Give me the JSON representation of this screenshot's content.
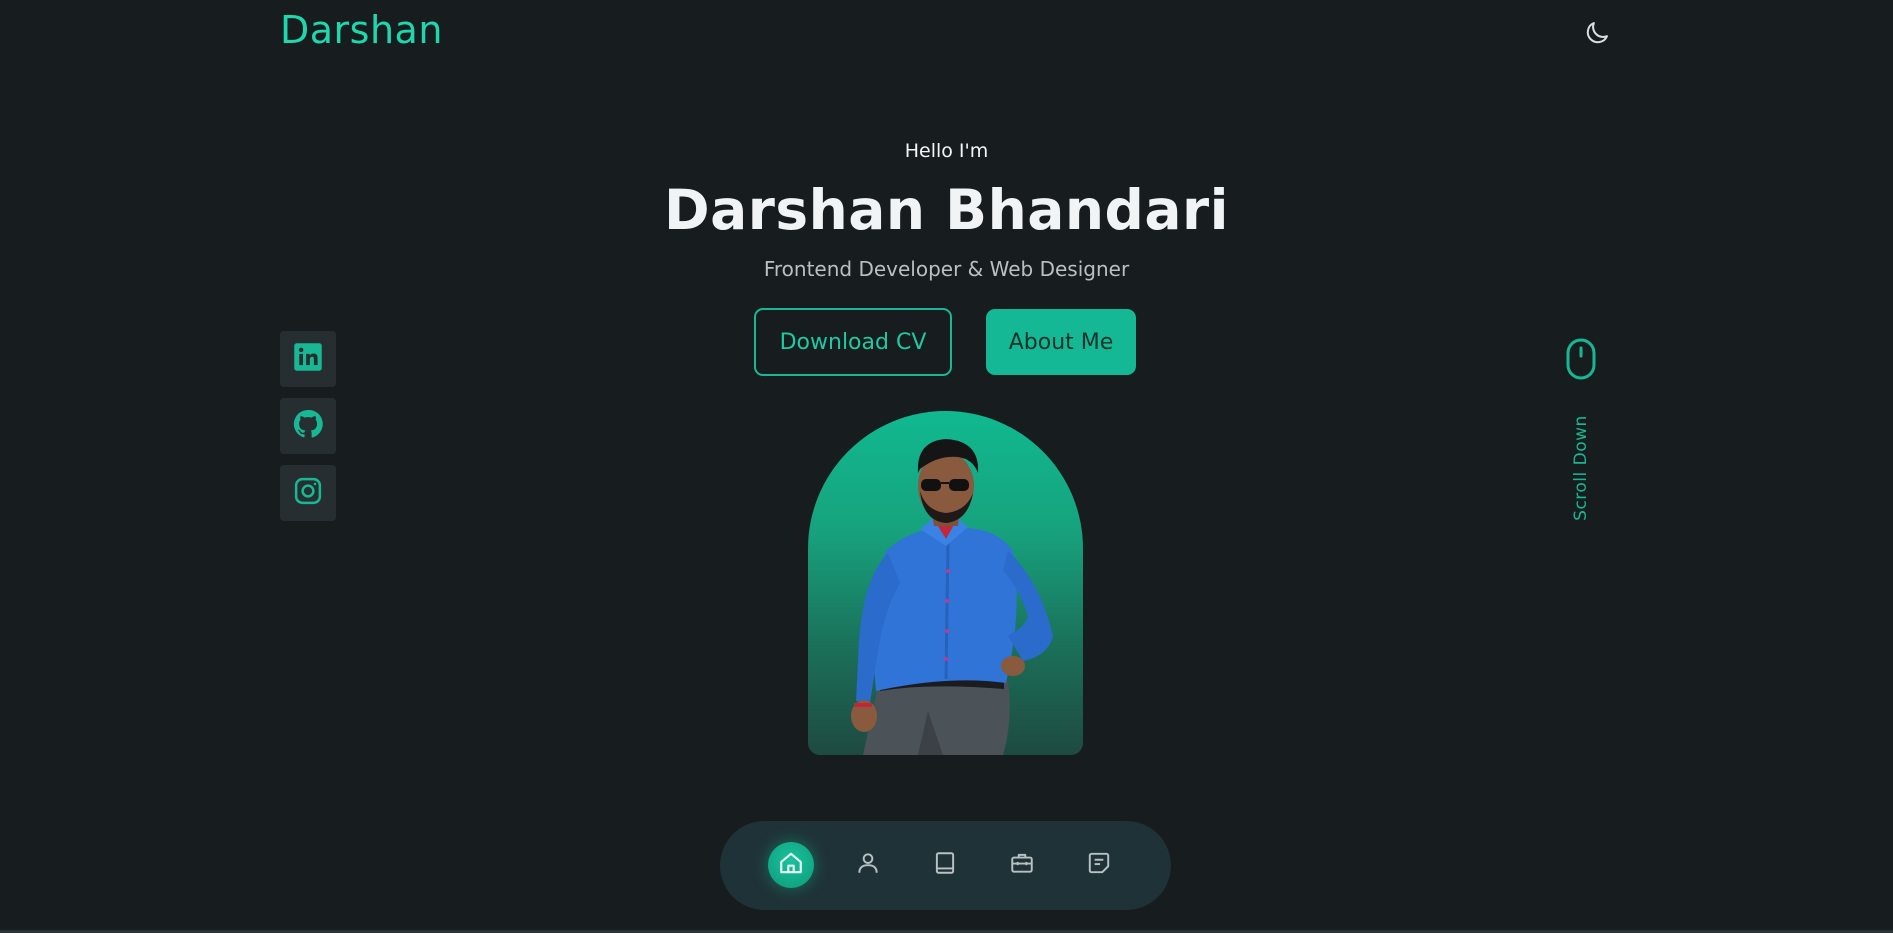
{
  "header": {
    "logo": "Darshan",
    "theme_icon": "moon-icon"
  },
  "hero": {
    "greeting": "Hello I'm",
    "name": "Darshan Bhandari",
    "role": "Frontend Developer & Web Designer",
    "buttons": {
      "download_cv": "Download CV",
      "about_me": "About Me"
    }
  },
  "social": [
    {
      "icon": "linkedin-icon"
    },
    {
      "icon": "github-icon"
    },
    {
      "icon": "instagram-icon"
    }
  ],
  "scroll": {
    "label": "Scroll Down",
    "icon": "mouse-icon"
  },
  "nav": {
    "items": [
      {
        "icon": "home-icon",
        "active": true
      },
      {
        "icon": "user-icon",
        "active": false
      },
      {
        "icon": "book-icon",
        "active": false
      },
      {
        "icon": "briefcase-icon",
        "active": false
      },
      {
        "icon": "message-icon",
        "active": false
      }
    ]
  },
  "colors": {
    "background": "#171c1f",
    "accent": "#1fd7ad",
    "button_fill": "#14b894",
    "nav_bg": "#1f3237"
  }
}
